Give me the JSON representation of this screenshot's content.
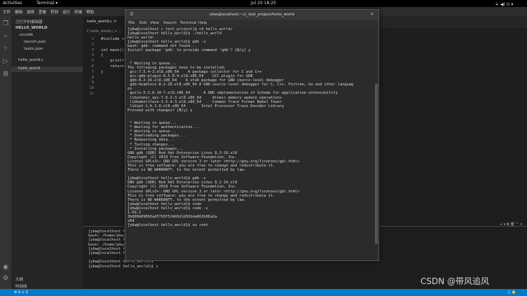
{
  "topbar": {
    "activities": "Activities",
    "app": "Terminal ▾",
    "clock": "Jul 20  18:25",
    "tray": "⏚ ◀) ⏻ ▾"
  },
  "vscode": {
    "menus": [
      "文件",
      "编辑",
      "选择",
      "查看",
      "转到",
      "运行",
      "终端",
      "帮助"
    ],
    "sidebar_title": "已打开的编辑器",
    "folder": "HELLO_WORLD",
    "files": [
      ".vscode",
      "launch.json",
      "tasks.json",
      "hello_world.c",
      "hello_world"
    ],
    "tab": "hello_world.c ×",
    "breadcrumb": "C hello_world.c > ...",
    "code": [
      {
        "n": "1",
        "t": "#include <stdio.h>"
      },
      {
        "n": "2",
        "t": ""
      },
      {
        "n": "3",
        "t": "int main()"
      },
      {
        "n": "4",
        "t": "{"
      },
      {
        "n": "5",
        "t": "    printf(\"hello world!\\n\");"
      },
      {
        "n": "6",
        "t": "    return 0;"
      },
      {
        "n": "7",
        "t": "}"
      },
      {
        "n": "8",
        "t": ""
      },
      {
        "n": "9",
        "t": ""
      },
      {
        "n": "10",
        "t": ""
      },
      {
        "n": "11",
        "t": ""
      }
    ],
    "outline": "大纲",
    "timeline": "时间线",
    "panel_ctrl": "+ ▾ ⧉ 🗑 ^ ×",
    "bottom_terminal": "[ybw@localhost he\nbash: /home/ybw/.v\n[ybw@localhost he\nbash: /home/ybw/.v\n[ybw@localhost hel\n[ybw@localhost hello_world]$\n\n[ybw@localhost hello_world]$\n[ybw@localhost hello_world]$ ▯",
    "status_left": "⊗ 0 ⚠ 0",
    "status_right": "♫ 🔔"
  },
  "terminal": {
    "title": "ybw@localhost:~/c_test_project/hello_world",
    "menu": [
      "File",
      "Edit",
      "View",
      "Search",
      "Terminal",
      "Help"
    ],
    "lines": "[ybw@localhost c_test_project]$ cd hello_world/\n[ybw@localhost hello_world]$ ./hello_world\nhello world!\n[ybw@localhost hello_world]$ gdb -v\nbash: gdb: command not found...\nInstall package 'gdb' to provide command 'gdb'? [N/y] y\n\n\n * Waiting in queue...\nThe following packages have to be installed:\n gcc-7.5.4-3.el8.x86_64    A package collector for C and C++\n gcc-gdb-plugin-8.5.0-4.el8.x86_64    GCC plugin for GDB\n gdb-8.2-16.el8.x86_64    A stub package for GNU source-level debugger\n gdb-headless-8.2-16.el8.x86_64 A GNU source-level debugger for C, C++, Fortran, Go and other languag\nes\n guile-5:2.0.14-7.el8.x86_64      A GNU implementation of Scheme for application extensibility\n libatomic_ops-7.6.2-3.el8.x86_64     Atomic memory update operations\n libbabeltrace-1.5.4-3.el8.x86_64     Common Trace Format Babel Tower\n libipt-1.6.1-8.el8.x86_64       Intel Processor Trace Decoder Library\nProceed with changes? [N/y] y\n\n\n * Waiting in queue...\n * Waiting for authentication...\n * Waiting in queue...\n * Downloading packages...\n * Requesting data...\n * Testing changes...\n * Installing packages...\nGNU gdb (GDB) Red Hat Enterprise Linux 8.2-16.el8\nCopyright (C) 2018 Free Software Foundation, Inc.\nLicense GPLv3+: GNU GPL version 3 or later <http://gnu.org/licenses/gpl.html>\nThis is free software: you are free to change and redistribute it.\nThere is NO WARRANTY, to the extent permitted by law.\n\n[ybw@localhost hello_world]$ gdb -v\nGNU gdb (GDB) Red Hat Enterprise Linux 8.2-16.el8\nCopyright (C) 2018 Free Software Foundation, Inc.\nLicense GPLv3+: GNU GPL version 3 or later <http://gnu.org/licenses/gpl.html>\nThis is free software: you are free to change and redistribute it.\nThere is NO WARRANTY, to the extent permitted by law.\n[ybw@localhost hello_world]$ code\n[ybw@localhost hello_world]$ code -v\n1.69.2\n3b889b090b5ad5793f524b5d1d391da662b96a2a\nx64\n[ybw@localhost hello_world]$ su root"
  },
  "watermark": "CSDN @带风追风"
}
